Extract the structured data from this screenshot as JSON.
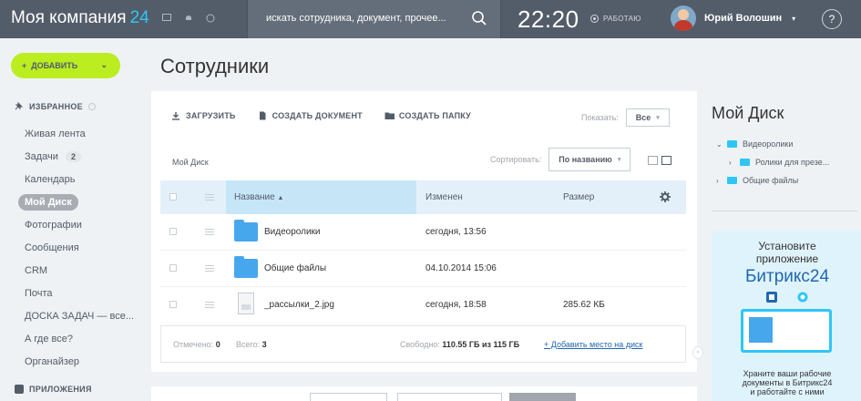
{
  "header": {
    "company_name": "Моя компания",
    "company_num": "24",
    "search_placeholder": "искать сотрудника, документ, прочее...",
    "time": "22:20",
    "work_status": "РАБОТАЮ",
    "user_name": "Юрий Волошин",
    "help_label": "?"
  },
  "sidebar": {
    "add_label": "ДОБАВИТЬ",
    "favorites_label": "ИЗБРАННОЕ",
    "items": [
      {
        "label": "Живая лента"
      },
      {
        "label": "Задачи",
        "count": "2"
      },
      {
        "label": "Календарь"
      },
      {
        "label": "Мой Диск",
        "active": true
      },
      {
        "label": "Фотографии"
      },
      {
        "label": "Сообщения"
      },
      {
        "label": "CRM"
      },
      {
        "label": "Почта"
      },
      {
        "label": "ДОСКА ЗАДАЧ — все..."
      },
      {
        "label": "А где все?"
      },
      {
        "label": "Органайзер"
      }
    ],
    "apps_label": "ПРИЛОЖЕНИЯ"
  },
  "page_title": "Сотрудники",
  "toolbar": {
    "upload": "ЗАГРУЗИТЬ",
    "create_doc": "СОЗДАТЬ ДОКУМЕНТ",
    "create_folder": "СОЗДАТЬ ПАПКУ",
    "show_label": "Показать:",
    "show_value": "Все"
  },
  "breadcrumb": "Мой Диск",
  "sort": {
    "label": "Сортировать:",
    "value": "По названию"
  },
  "table": {
    "columns": {
      "name": "Название",
      "changed": "Изменен",
      "size": "Размер"
    },
    "rows": [
      {
        "name": "Видеоролики",
        "changed": "сегодня, 13:56",
        "size": "",
        "type": "folder"
      },
      {
        "name": "Общие файлы",
        "changed": "04.10.2014 15:06",
        "size": "",
        "type": "folder"
      },
      {
        "name": "_рассылки_2.jpg",
        "changed": "сегодня, 18:58",
        "size": "285.62 КБ",
        "type": "file"
      }
    ]
  },
  "footer": {
    "marked_label": "Отмечено:",
    "marked_value": "0",
    "total_label": "Всего:",
    "total_value": "3",
    "free_label": "Свободно:",
    "free_value": "110.55 ГБ из 115 ГБ",
    "add_space": "+ Добавить место на диск"
  },
  "right_panel": {
    "title": "Мой Диск",
    "tree": [
      {
        "label": "Видеоролики",
        "expanded": true,
        "level": 0
      },
      {
        "label": "Ролики для презе...",
        "expanded": false,
        "level": 1
      },
      {
        "label": "Общие файлы",
        "expanded": false,
        "level": 0
      }
    ],
    "promo": {
      "line1": "Установите",
      "line2": "приложение",
      "brand": "Битрикс24",
      "caption1": "Храните ваши рабочие",
      "caption2": "документы в Битрикс24",
      "caption3": "и работайте с ними"
    }
  },
  "colors": {
    "header_bg": "#535c69",
    "accent_green": "#bbed21",
    "accent_blue": "#2fc6f6",
    "link": "#2067b0"
  }
}
